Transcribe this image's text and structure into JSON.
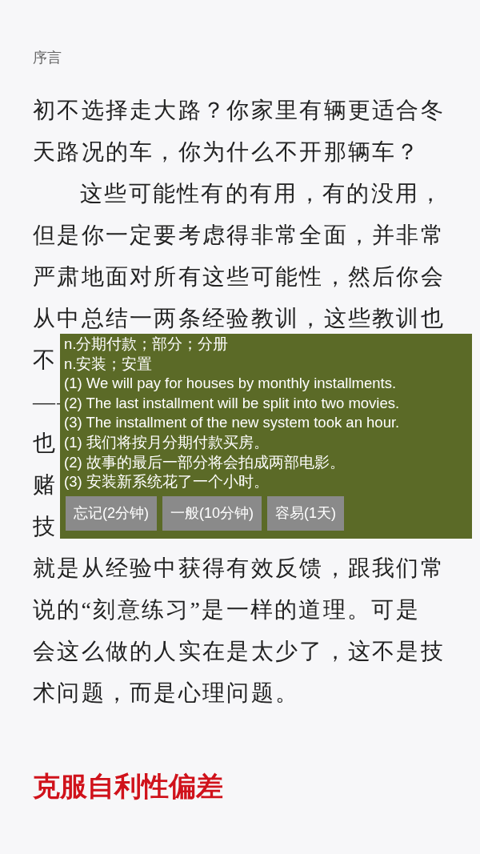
{
  "header": {
    "title": "序言"
  },
  "body": {
    "lines": [
      {
        "text": "初不选择走大路？你家里有辆更适合冬",
        "kind": "continuation"
      },
      {
        "text": "天路况的车，你为什么不开那辆车？",
        "kind": "continuation"
      },
      {
        "text": "这些可能性有的有用，有的没用，",
        "kind": "paragraph-start"
      },
      {
        "text": "但是你一定要考虑得非常全面，并非常",
        "kind": "continuation"
      },
      {
        "text": "严肃地面对所有这些可能性，然后你会",
        "kind": "continuation"
      },
      {
        "text": "从中总结一两条经验教训，这些教训也",
        "kind": "continuation"
      },
      {
        "text": "不",
        "kind": "continuation"
      },
      {
        "text": "——",
        "kind": "continuation"
      },
      {
        "text": "也",
        "kind": "continuation"
      },
      {
        "text": "赌",
        "kind": "continuation"
      },
      {
        "text": "技",
        "kind": "continuation"
      },
      {
        "text": "就是从经验中获得有效反馈，跟我们常",
        "kind": "continuation"
      },
      {
        "text": "说的“刻意练习”是一样的道理。可是",
        "kind": "continuation"
      },
      {
        "text": "会这么做的人实在是太少了，这不是技",
        "kind": "continuation"
      },
      {
        "text": "术问题，而是心理问题。",
        "kind": "continuation"
      }
    ]
  },
  "heading": "克服自利性偏差",
  "popup": {
    "lines": [
      "n.分期付款；部分；分册",
      "n.安装；安置",
      "(1) We will pay for houses by monthly installments.",
      "(2) The last installment will be split into two movies.",
      "(3) The installment of the new system took an hour.",
      "(1) 我们将按月分期付款买房。",
      "(2) 故事的最后一部分将会拍成两部电影。",
      "(3) 安装新系统花了一个小时。"
    ],
    "buttons": [
      "忘记(2分钟)",
      "一般(10分钟)",
      "容易(1天)"
    ]
  }
}
